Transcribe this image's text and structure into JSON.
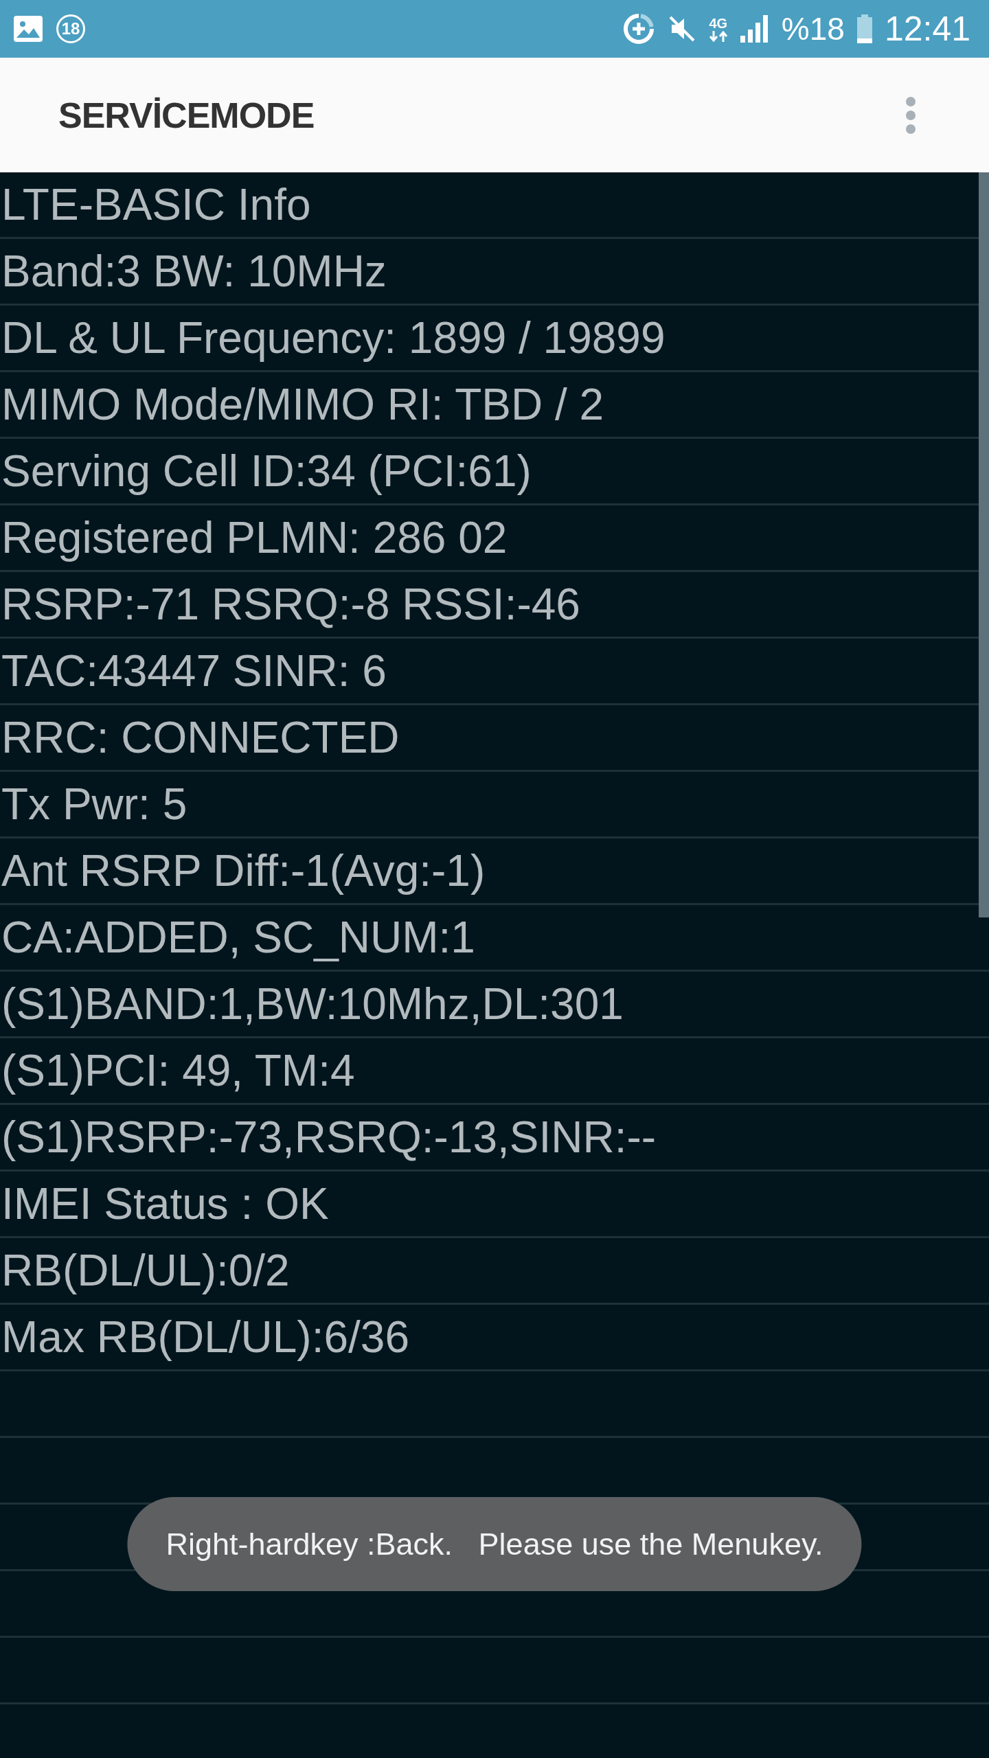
{
  "status_bar": {
    "notification_count": "18",
    "network_type": "4G",
    "battery": "%18",
    "time": "12:41"
  },
  "app_bar": {
    "title": "SERVİCEMODE"
  },
  "rows": [
    "LTE-BASIC Info",
    "Band:3 BW: 10MHz",
    "DL & UL Frequency: 1899 / 19899",
    "MIMO Mode/MIMO RI: TBD / 2",
    "Serving Cell ID:34 (PCI:61)",
    "Registered PLMN: 286 02",
    "RSRP:-71 RSRQ:-8 RSSI:-46",
    "TAC:43447 SINR: 6",
    "RRC: CONNECTED",
    "Tx Pwr: 5",
    "Ant RSRP Diff:-1(Avg:-1)",
    "CA:ADDED, SC_NUM:1",
    "(S1)BAND:1,BW:10Mhz,DL:301",
    "(S1)PCI: 49, TM:4",
    "(S1)RSRP:-73,RSRQ:-13,SINR:--",
    "IMEI Status : OK",
    "RB(DL/UL):0/2",
    "Max RB(DL/UL):6/36"
  ],
  "toast": {
    "text": "Right-hardkey :Back.   Please use the Menukey."
  }
}
